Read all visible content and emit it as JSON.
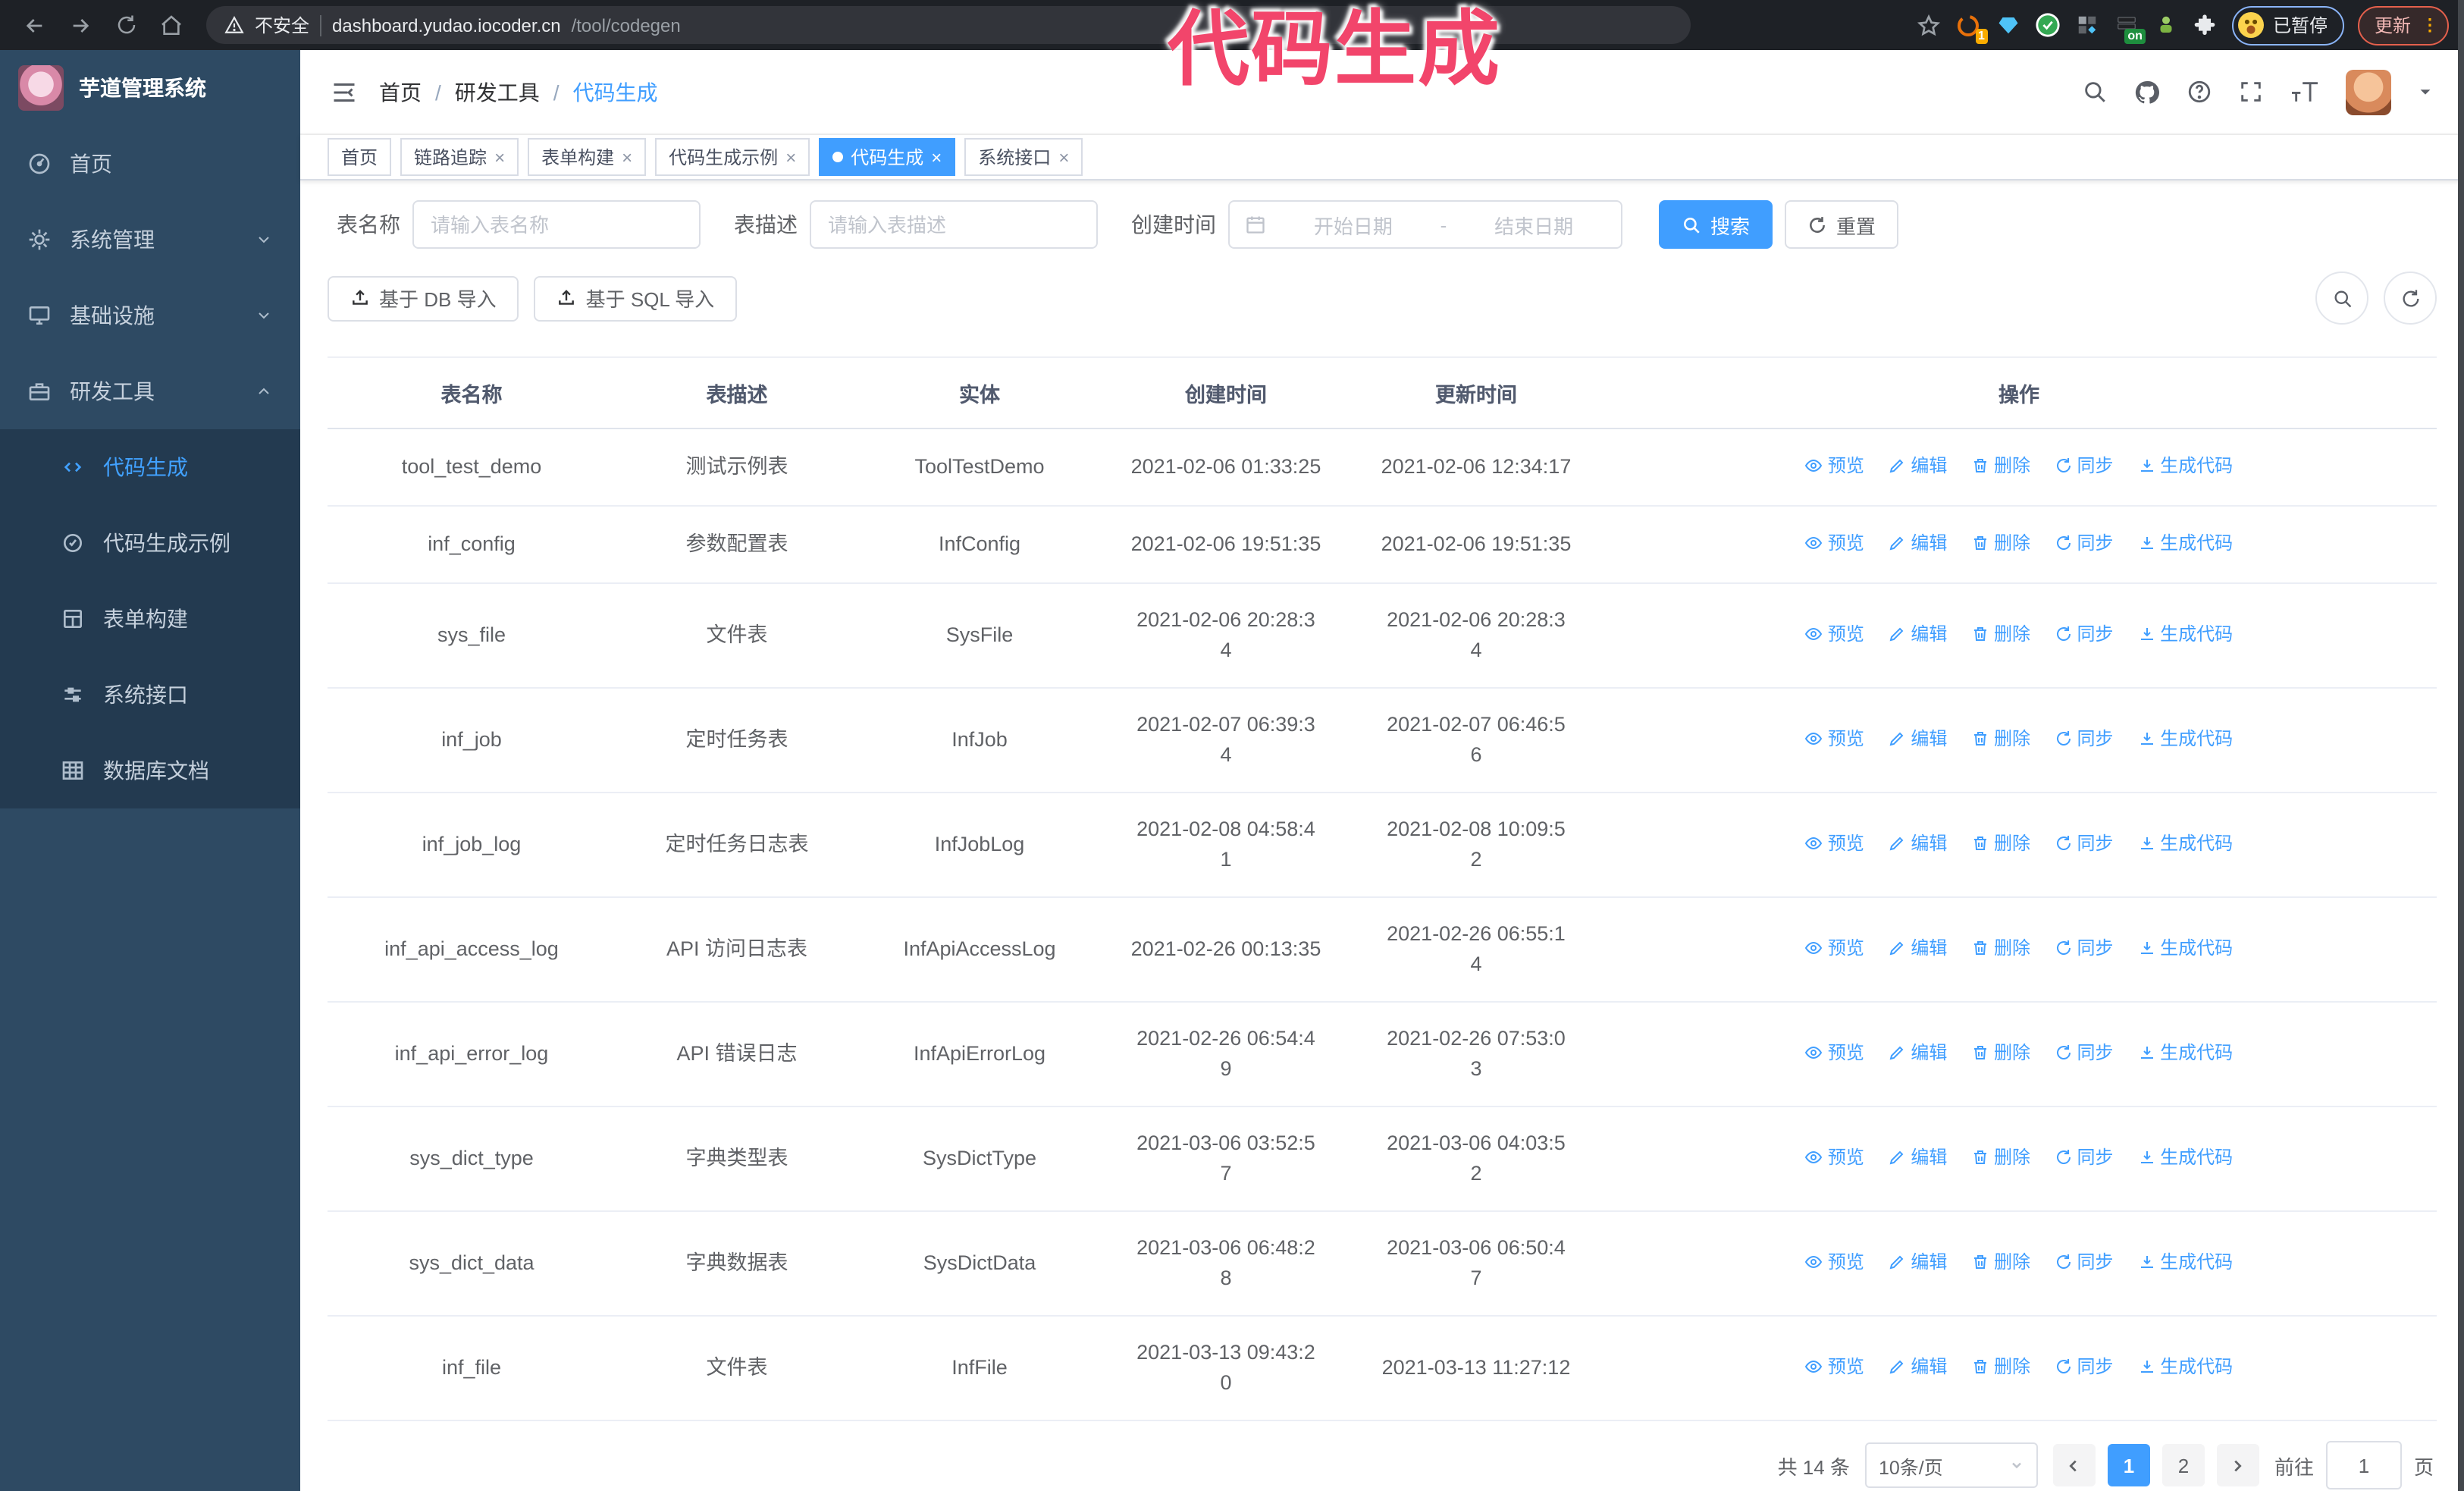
{
  "browser": {
    "security_warning": "不安全",
    "url_host": "dashboard.yudao.iocoder.cn",
    "url_path": "/tool/codegen",
    "ext_badge_count": "1",
    "ext_on_badge": "on",
    "paused_badge": "已暂停",
    "update_button": "更新",
    "menu_dots": "⋮"
  },
  "annotation": {
    "text": "代码生成",
    "color": "#f2456b"
  },
  "sidebar": {
    "title": "芋道管理系统",
    "items": [
      {
        "label": "首页"
      },
      {
        "label": "系统管理"
      },
      {
        "label": "基础设施"
      },
      {
        "label": "研发工具"
      }
    ],
    "submenu": [
      {
        "label": "代码生成"
      },
      {
        "label": "代码生成示例"
      },
      {
        "label": "表单构建"
      },
      {
        "label": "系统接口"
      },
      {
        "label": "数据库文档"
      }
    ]
  },
  "header": {
    "breadcrumb": [
      "首页",
      "研发工具",
      "代码生成"
    ],
    "separator": "/"
  },
  "tabs": [
    {
      "label": "首页"
    },
    {
      "label": "链路追踪"
    },
    {
      "label": "表单构建"
    },
    {
      "label": "代码生成示例"
    },
    {
      "label": "代码生成"
    },
    {
      "label": "系统接口"
    }
  ],
  "filters": {
    "name_label": "表名称",
    "name_placeholder": "请输入表名称",
    "desc_label": "表描述",
    "desc_placeholder": "请输入表描述",
    "time_label": "创建时间",
    "start_placeholder": "开始日期",
    "range_separator": "-",
    "end_placeholder": "结束日期",
    "search_label": "搜索",
    "reset_label": "重置"
  },
  "toolbar": {
    "db_import": "基于 DB 导入",
    "sql_import": "基于 SQL 导入"
  },
  "table": {
    "columns": [
      "表名称",
      "表描述",
      "实体",
      "创建时间",
      "更新时间",
      "操作"
    ],
    "action_labels": [
      "预览",
      "编辑",
      "删除",
      "同步",
      "生成代码"
    ],
    "rows": [
      {
        "name": "tool_test_demo",
        "description": "测试示例表",
        "entity": "ToolTestDemo",
        "created": "2021-02-06 01:33:25",
        "updated": "2021-02-06 12:34:17"
      },
      {
        "name": "inf_config",
        "description": "参数配置表",
        "entity": "InfConfig",
        "created": "2021-02-06 19:51:35",
        "updated": "2021-02-06 19:51:35"
      },
      {
        "name": "sys_file",
        "description": "文件表",
        "entity": "SysFile",
        "created": "2021-02-06 20:28:3\n4",
        "updated": "2021-02-06 20:28:3\n4"
      },
      {
        "name": "inf_job",
        "description": "定时任务表",
        "entity": "InfJob",
        "created": "2021-02-07 06:39:3\n4",
        "updated": "2021-02-07 06:46:5\n6"
      },
      {
        "name": "inf_job_log",
        "description": "定时任务日志表",
        "entity": "InfJobLog",
        "created": "2021-02-08 04:58:4\n1",
        "updated": "2021-02-08 10:09:5\n2"
      },
      {
        "name": "inf_api_access_log",
        "description": "API 访问日志表",
        "entity": "InfApiAccessLog",
        "created": "2021-02-26 00:13:35",
        "updated": "2021-02-26 06:55:1\n4"
      },
      {
        "name": "inf_api_error_log",
        "description": "API 错误日志",
        "entity": "InfApiErrorLog",
        "created": "2021-02-26 06:54:4\n9",
        "updated": "2021-02-26 07:53:0\n3"
      },
      {
        "name": "sys_dict_type",
        "description": "字典类型表",
        "entity": "SysDictType",
        "created": "2021-03-06 03:52:5\n7",
        "updated": "2021-03-06 04:03:5\n2"
      },
      {
        "name": "sys_dict_data",
        "description": "字典数据表",
        "entity": "SysDictData",
        "created": "2021-03-06 06:48:2\n8",
        "updated": "2021-03-06 06:50:4\n7"
      },
      {
        "name": "inf_file",
        "description": "文件表",
        "entity": "InfFile",
        "created": "2021-03-13 09:43:2\n0",
        "updated": "2021-03-13 11:27:12"
      }
    ]
  },
  "pagination": {
    "total": "共 14 条",
    "page_size": "10条/页",
    "pages": [
      "1",
      "2"
    ],
    "goto_label": "前往",
    "goto_value": "1",
    "page_unit": "页"
  },
  "colors": {
    "accent": "#409eff",
    "sidebar": "#2e4a63",
    "annotation": "#f2456b"
  }
}
